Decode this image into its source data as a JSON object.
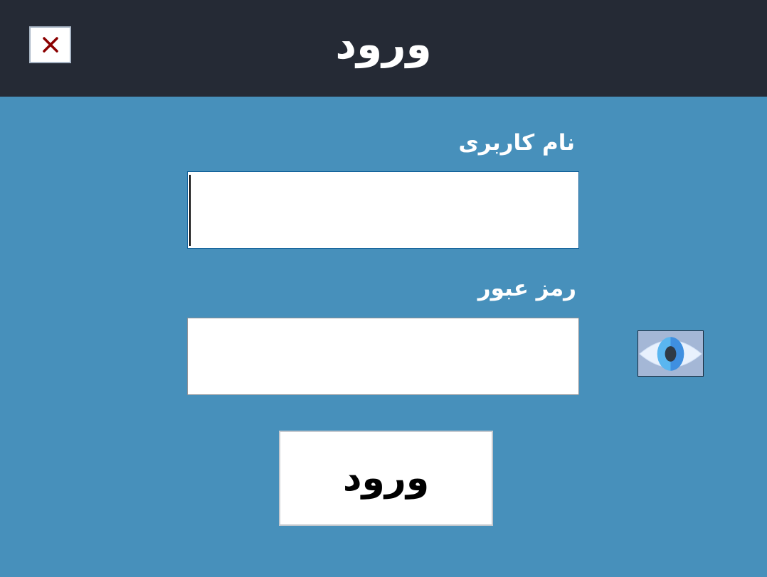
{
  "header": {
    "title": "ورود",
    "close_icon": "close-icon"
  },
  "form": {
    "username_label": "نام کاربری",
    "username_value": "",
    "password_label": "رمز عبور",
    "password_value": "",
    "toggle_visibility_icon": "eye-icon",
    "submit_label": "ورود"
  },
  "colors": {
    "header_bg": "#252a35",
    "body_bg": "#4790bb",
    "close_x": "#8b0000"
  }
}
